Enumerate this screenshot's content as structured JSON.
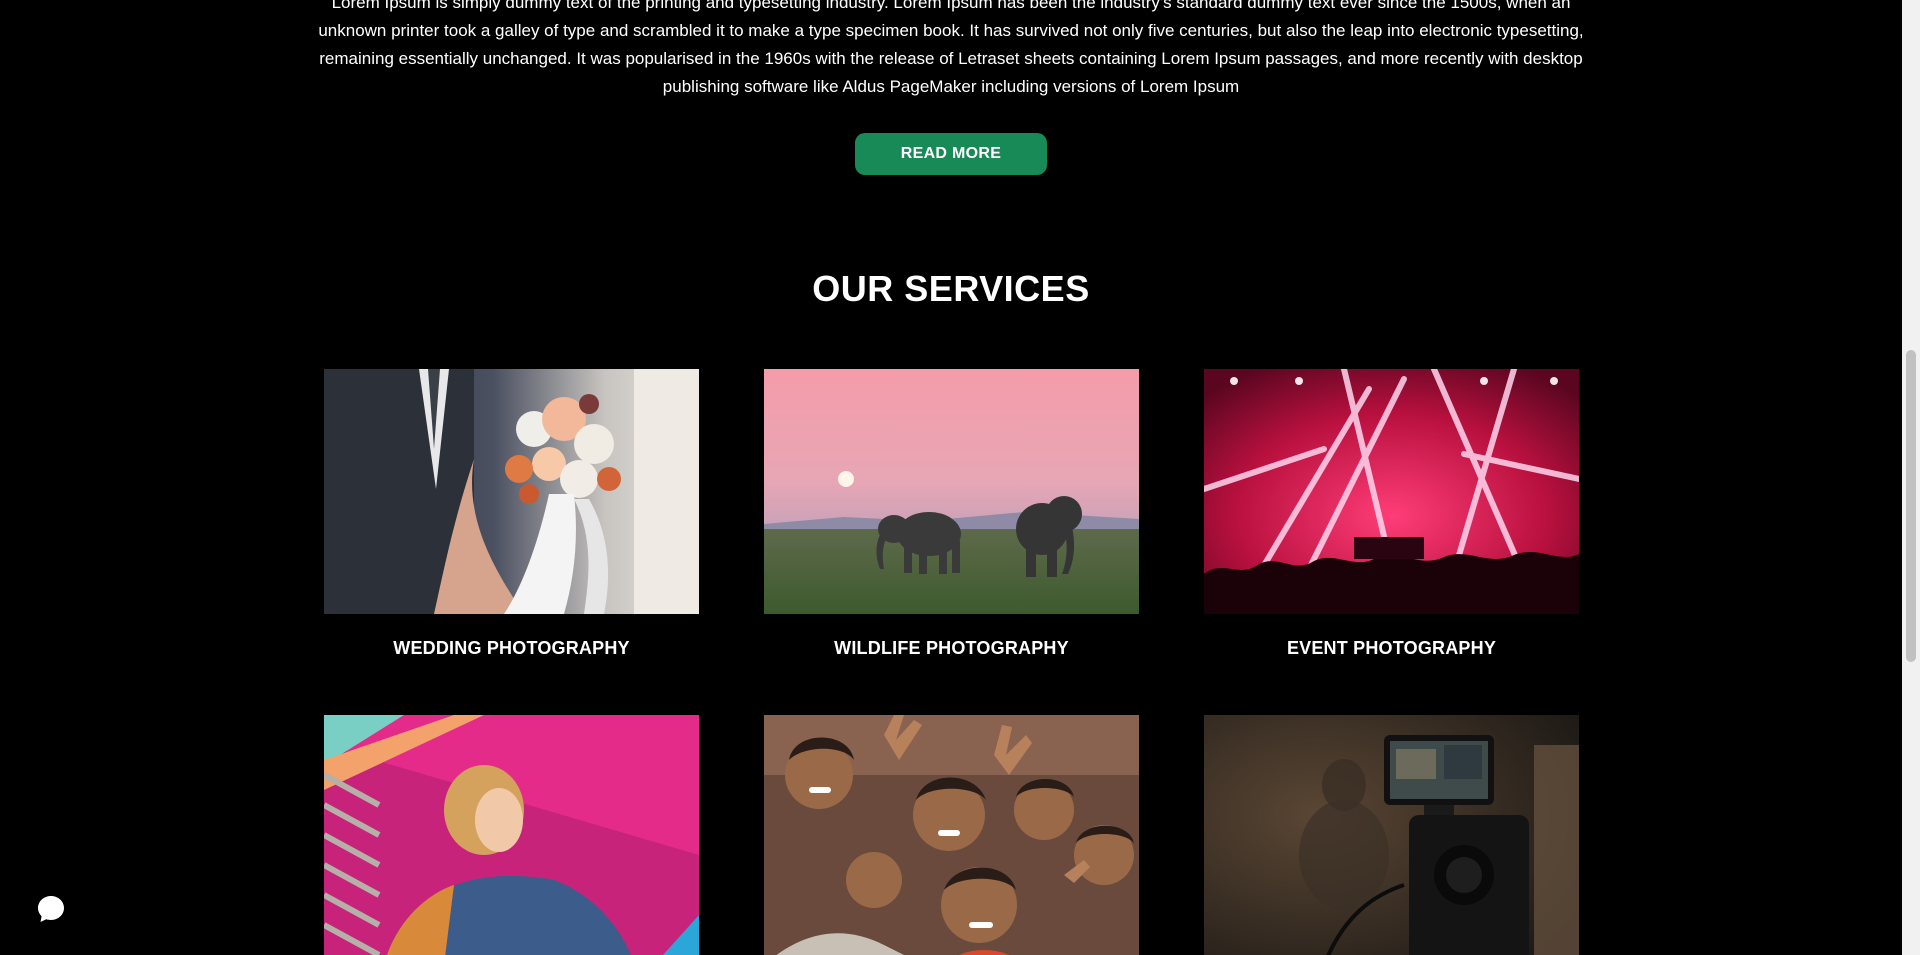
{
  "intro": {
    "paragraph": "Lorem Ipsum is simply dummy text of the printing and typesetting industry. Lorem Ipsum has been the industry's standard dummy text ever since the 1500s, when an unknown printer took a galley of type and scrambled it to make a type specimen book. It has survived not only five centuries, but also the leap into electronic typesetting, remaining essentially unchanged. It was popularised in the 1960s with the release of Letraset sheets containing Lorem Ipsum passages, and more recently with desktop publishing software like Aldus PageMaker including versions of Lorem Ipsum",
    "read_more_label": "READ MORE"
  },
  "services": {
    "title": "OUR SERVICES",
    "items": [
      {
        "label": "WEDDING PHOTOGRAPHY"
      },
      {
        "label": "WILDLIFE PHOTOGRAPHY"
      },
      {
        "label": "EVENT PHOTOGRAPHY"
      },
      {
        "label": ""
      },
      {
        "label": ""
      },
      {
        "label": ""
      }
    ]
  },
  "colors": {
    "background": "#000000",
    "accent": "#188a57",
    "text": "#ffffff"
  },
  "icons": {
    "chat": "chat-bubble-icon"
  }
}
